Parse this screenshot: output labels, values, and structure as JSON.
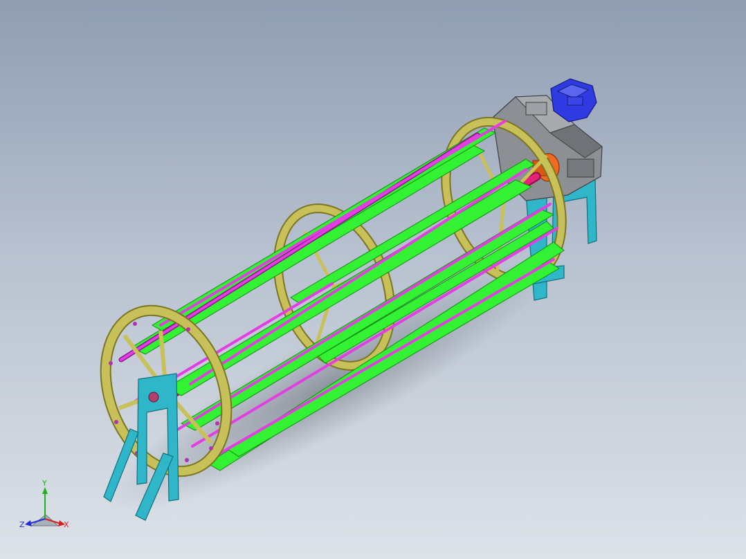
{
  "viewport": {
    "background_top": "#8f9db2",
    "background_bottom": "#dde2e9"
  },
  "model": {
    "colors": {
      "ring": "#c8c15a",
      "ring_edge": "#7b7420",
      "slat": "#33f233",
      "slat_edge": "#138a13",
      "rod": "#e23ee2",
      "rod_edge": "#8a168a",
      "shaft": "#e6217a",
      "stand": "#2fb7c9",
      "stand_edge": "#0f6f7c",
      "gearbox": "#8c8f93",
      "motor": "#2f3be0",
      "coupling": "#f06a20"
    },
    "icons": [
      "gearbox-icon",
      "motor-icon",
      "coupling-icon"
    ]
  },
  "triad": {
    "x_label": "X",
    "y_label": "Y",
    "z_label": "Z",
    "x_color": "#d62020",
    "y_color": "#20b020",
    "z_color": "#2030d0"
  }
}
